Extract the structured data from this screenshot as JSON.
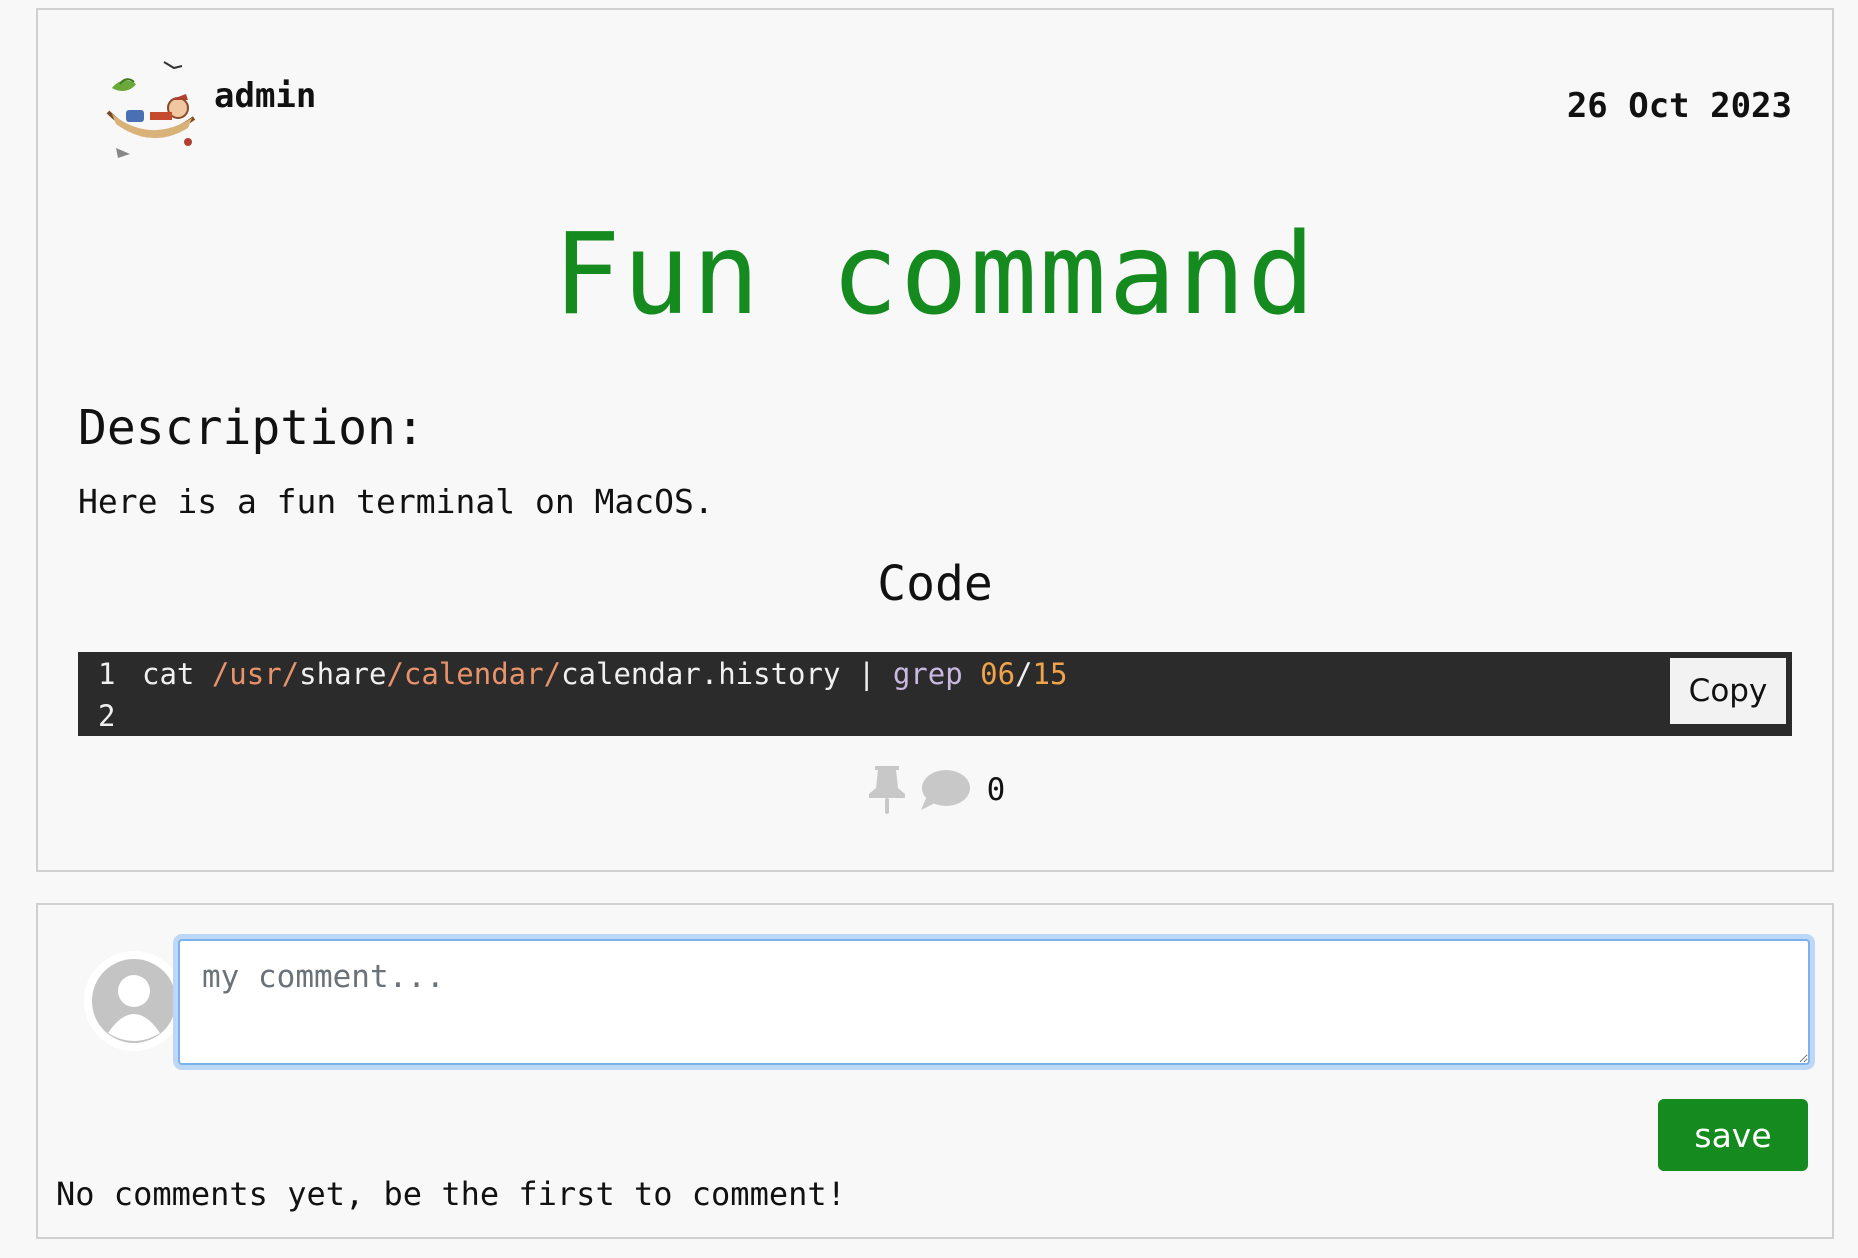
{
  "post": {
    "author": "admin",
    "date": "26 Oct 2023",
    "title": "Fun command",
    "description_heading": "Description:",
    "description": "Here is a fun terminal on MacOS.",
    "code_heading": "Code",
    "code": {
      "line_numbers": [
        "1",
        "2"
      ],
      "tokens": [
        {
          "text": "cat ",
          "kind": "plain"
        },
        {
          "text": "/usr/",
          "kind": "path"
        },
        {
          "text": "share",
          "kind": "plain"
        },
        {
          "text": "/calendar/",
          "kind": "path"
        },
        {
          "text": "calendar.history | ",
          "kind": "plain"
        },
        {
          "text": "grep ",
          "kind": "cmd"
        },
        {
          "text": "06",
          "kind": "num"
        },
        {
          "text": "/",
          "kind": "plain"
        },
        {
          "text": "15",
          "kind": "num"
        }
      ],
      "copy_label": "Copy"
    },
    "comment_count": "0"
  },
  "comments": {
    "placeholder": "my comment...",
    "save_label": "save",
    "empty_message": "No comments yet, be the first to comment!"
  },
  "colors": {
    "title": "#158a1f",
    "save_button": "#158a1f",
    "code_background": "#2b2b2b"
  }
}
